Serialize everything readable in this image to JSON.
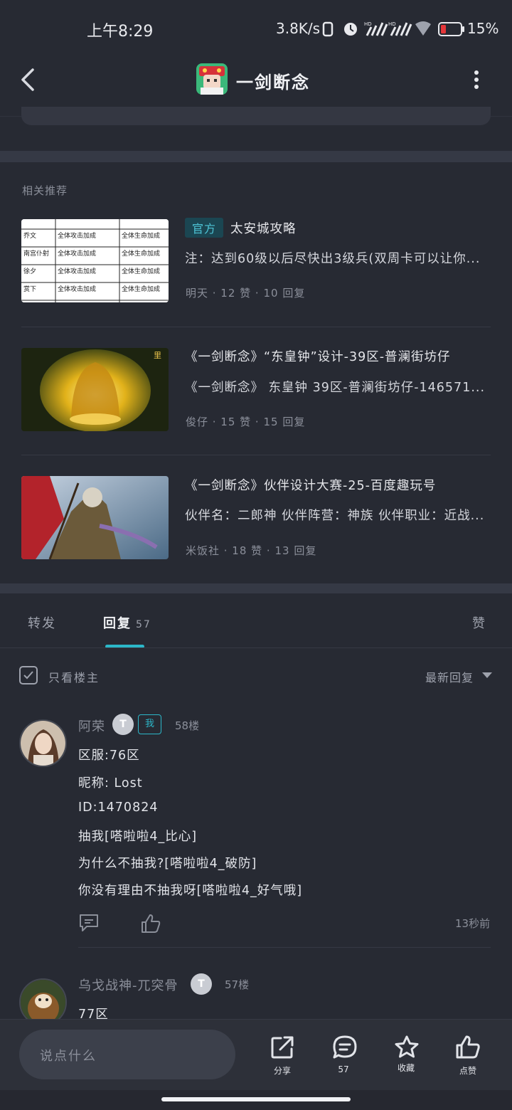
{
  "status_bar": {
    "time": "上午8:29",
    "net_speed": "3.8K/s",
    "battery": "15%"
  },
  "header": {
    "title": "一剑断念"
  },
  "recommendations": {
    "label": "相关推荐",
    "items": [
      {
        "badge": "官方",
        "title": "太安城攻略",
        "desc": "注：达到60级以后尽快出3级兵(双周卡可以让你...",
        "meta": "明天 · 12 赞 · 10 回复",
        "thumb_table": [
          [
            "",
            "",
            ""
          ],
          [
            "乔文",
            "全体攻击加成",
            "全体生命加成"
          ],
          [
            "南宫仆射",
            "全体攻击加成",
            "全体生命加成"
          ],
          [
            "徐夕",
            "全体攻击加成",
            "全体生命加成"
          ],
          [
            "赏下",
            "全体攻击加成",
            "全体生命加成"
          ]
        ]
      },
      {
        "title": "《一剑断念》“东皇钟”设计-39区-普澜街坊仔",
        "desc": "《一剑断念》 东皇钟 39区-普澜街坊仔-146571...",
        "meta": "俊仔 · 15 赞 · 15 回复"
      },
      {
        "title": "《一剑断念》伙伴设计大赛-25-百度趣玩号",
        "desc": "伙伴名：二郎神 伙伴阵营：神族 伙伴职业：近战...",
        "meta": "米饭社 · 18 赞 · 13 回复"
      }
    ]
  },
  "tabs": {
    "forward": "转发",
    "reply": "回复",
    "reply_count": "57",
    "like": "赞"
  },
  "filter": {
    "only_op": "只看楼主",
    "sort": "最新回复"
  },
  "comments": [
    {
      "name": "阿荣",
      "level": "T",
      "me_badge": "我",
      "floor": "58楼",
      "lines": [
        "区服:76区",
        "昵称: Lost",
        "ID:1470824",
        "抽我[嗒啦啦4_比心]",
        "为什么不抽我?[嗒啦啦4_破防]",
        "你没有理由不抽我呀[嗒啦啦4_好气哦]"
      ],
      "time": "13秒前"
    },
    {
      "name": "乌戈战神-兀突骨",
      "level": "T",
      "floor": "57楼",
      "lines": [
        "77区"
      ]
    }
  ],
  "bottom_bar": {
    "placeholder": "说点什么",
    "share": "分享",
    "comment_count": "57",
    "favorite": "收藏",
    "like": "点赞"
  },
  "colors": {
    "background": "#272a33",
    "accent": "#2cb7c9",
    "official_badge_bg": "#1b4652"
  }
}
